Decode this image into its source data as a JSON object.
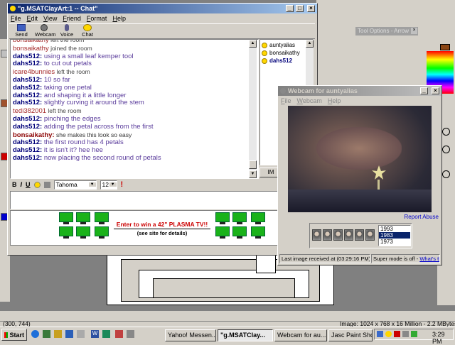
{
  "chat_window": {
    "title": "\"g.MSATClayArt:1 -- Chat\"",
    "menu": [
      "File",
      "Edit",
      "View",
      "Friend",
      "Format",
      "Help"
    ],
    "toolbar": [
      "Send File",
      "Webcam",
      "Voice",
      "Chat"
    ],
    "messages": [
      {
        "nick": "bonsaikathy",
        "text": "left the room",
        "type": "event"
      },
      {
        "nick": "bonsaikathy",
        "text": "joined the room",
        "type": "event"
      },
      {
        "nick": "dahs512:",
        "text": "using a small leaf kemper tool",
        "type": "msg"
      },
      {
        "nick": "dahs512:",
        "text": "to cut out petals",
        "type": "msg"
      },
      {
        "nick": "icare4bunnies",
        "text": "left the room",
        "type": "event"
      },
      {
        "nick": "dahs512:",
        "text": "10 so far",
        "type": "msg"
      },
      {
        "nick": "dahs512:",
        "text": "taking one petal",
        "type": "msg"
      },
      {
        "nick": "dahs512:",
        "text": "and shaping it a little longer",
        "type": "msg"
      },
      {
        "nick": "dahs512:",
        "text": "slightly curving it around the stem",
        "type": "msg"
      },
      {
        "nick": "tedi382001",
        "text": "left the room",
        "type": "event"
      },
      {
        "nick": "dahs512:",
        "text": "pinching the edges",
        "type": "msg"
      },
      {
        "nick": "dahs512:",
        "text": "adding the petal across from the first",
        "type": "msg"
      },
      {
        "nick": "bonsaikathy:",
        "text": "she makes this look so easy",
        "type": "msg2"
      },
      {
        "nick": "dahs512:",
        "text": "the first round has 4 petals",
        "type": "msg"
      },
      {
        "nick": "dahs512:",
        "text": "it is isn't it? hee hee",
        "type": "msg"
      },
      {
        "nick": "dahs512:",
        "text": "now placing the second round of petals",
        "type": "msg"
      }
    ],
    "users": [
      "auntyalias",
      "bonsaikathy",
      "dahs512"
    ],
    "im_label": "IM",
    "format": {
      "bold": "B",
      "italic": "I",
      "underline": "U",
      "font": "Tahoma",
      "size": "12"
    },
    "ad": {
      "headline": "Enter to win a 42\" PLASMA TV!!",
      "sub": "(see site for details)"
    }
  },
  "webcam_window": {
    "title": "Webcam for auntyalias",
    "menu": [
      "File",
      "Webcam",
      "Help"
    ],
    "report_link": "Report Abuse",
    "years": [
      "1993",
      "1983",
      "1973"
    ],
    "selected_year": "1983",
    "status_left": "Last image received at (03:29:16 PM)",
    "status_right_prefix": "Super mode is off - ",
    "status_right_link": "What's this?"
  },
  "psp": {
    "tool_options": "Tool Options - Arrow",
    "status_coords": "(300, 744)",
    "status_image": "Image:  1024 x 768 x 16 Million - 2.2 MBytes"
  },
  "taskbar": {
    "start": "Start",
    "tasks": [
      "Yahoo! Messen...",
      "\"g.MSATClay...",
      "Webcam for au...",
      "Jasc Paint Shop..."
    ],
    "active_task": 1,
    "clock": "3:29 PM"
  }
}
